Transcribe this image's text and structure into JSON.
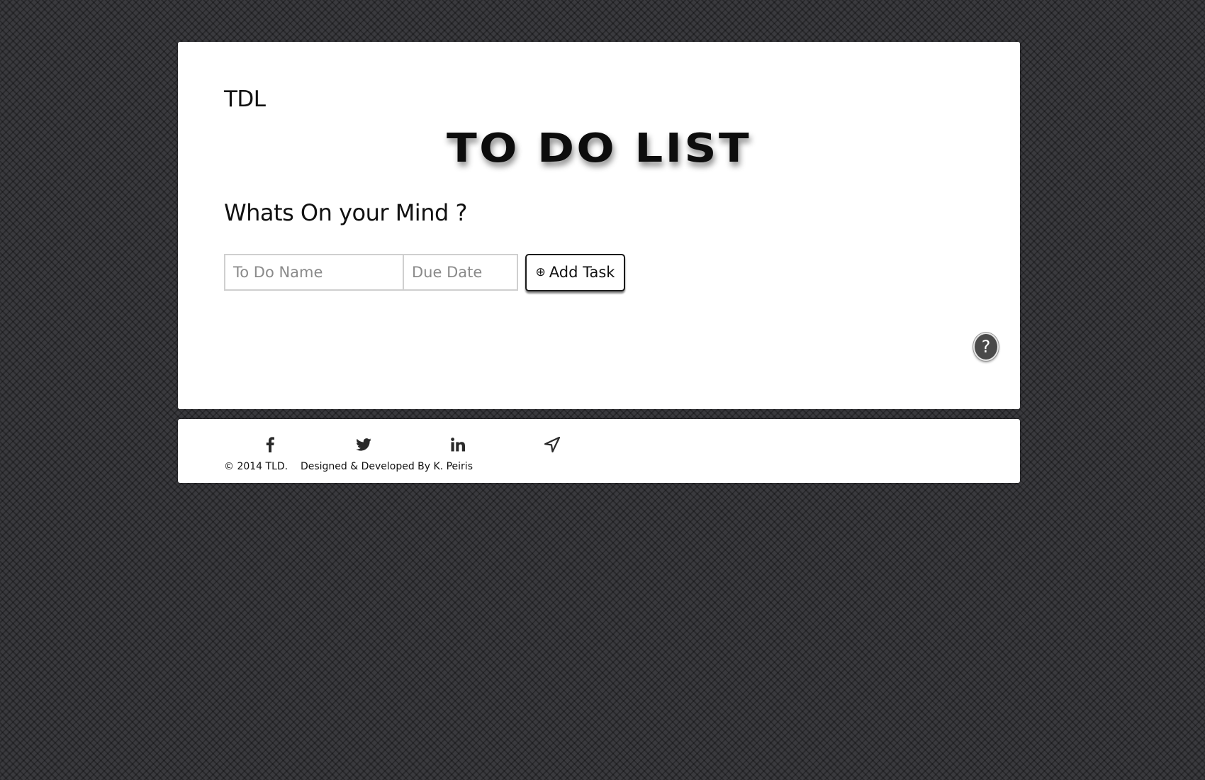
{
  "header": {
    "brand": "TDL",
    "title": "TO DO LIST"
  },
  "form": {
    "heading": "Whats On your Mind ?",
    "name_placeholder": "To Do Name",
    "date_placeholder": "Due Date",
    "add_icon": "⊕",
    "add_label": "Add Task"
  },
  "help": {
    "label": "?"
  },
  "footer": {
    "social": [
      "facebook-icon",
      "twitter-icon",
      "linkedin-icon",
      "location-arrow-icon"
    ],
    "copyright": "© 2014 TLD.",
    "credit": "Designed & Developed By K. Peiris"
  },
  "colors": {
    "background": "#3a3a3e",
    "card": "#ffffff",
    "text": "#111111",
    "help_button": "#4a4a4a"
  }
}
